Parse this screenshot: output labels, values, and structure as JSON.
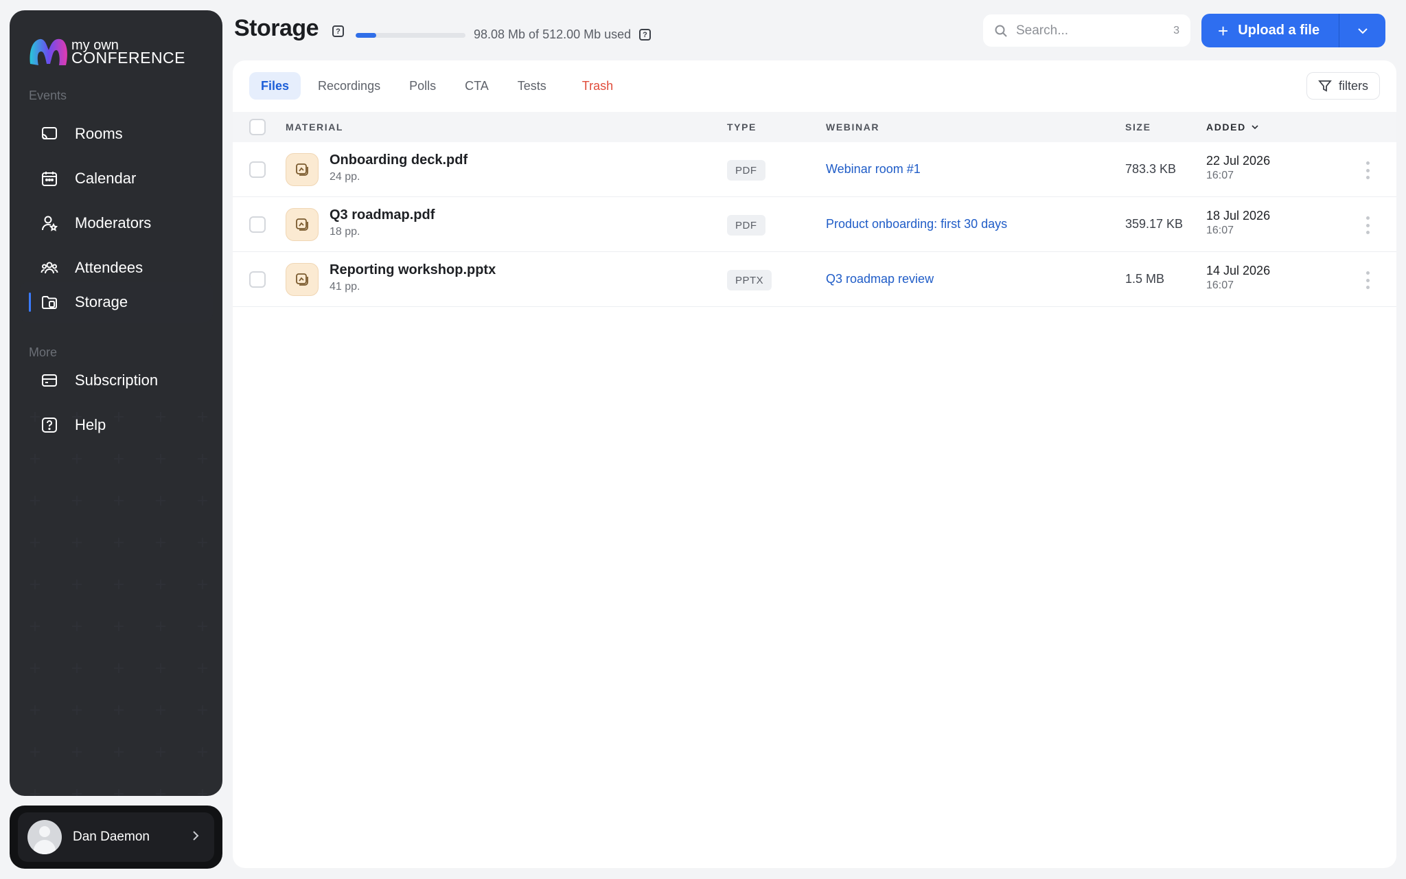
{
  "brand": {
    "line1": "my own",
    "line2": "CONFERENCE"
  },
  "sidebar": {
    "section_events": "Events",
    "section_more": "More",
    "items": [
      {
        "label": "Rooms",
        "icon": "cast-icon"
      },
      {
        "label": "Calendar",
        "icon": "calendar-icon"
      },
      {
        "label": "Moderators",
        "icon": "moderator-icon"
      },
      {
        "label": "Attendees",
        "icon": "attendees-icon"
      },
      {
        "label": "Storage",
        "icon": "storage-icon",
        "active": true
      },
      {
        "label": "Subscription",
        "icon": "card-icon"
      },
      {
        "label": "Help",
        "icon": "help-icon"
      }
    ],
    "user": {
      "name": "Dan Daemon"
    }
  },
  "header": {
    "title": "Storage",
    "usage_text": "98.08 Mb of 512.00 Mb used",
    "usage_fraction": 0.19,
    "search_placeholder": "Search...",
    "search_count": "3",
    "upload_label": "Upload a file"
  },
  "tabs": [
    {
      "label": "Files",
      "active": true
    },
    {
      "label": "Recordings"
    },
    {
      "label": "Polls"
    },
    {
      "label": "CTA"
    },
    {
      "label": "Tests"
    },
    {
      "label": "Trash",
      "danger": true
    }
  ],
  "filters_label": "filters",
  "table": {
    "headers": {
      "material": "MATERIAL",
      "type": "TYPE",
      "webinar": "WEBINAR",
      "size": "SIZE",
      "added": "ADDED"
    },
    "rows": [
      {
        "name": "Onboarding deck.pdf",
        "pages": "24 pp.",
        "type": "PDF",
        "webinar": "Webinar room #1",
        "size": "783.3 KB",
        "date": "22 Jul 2026",
        "time": "16:07"
      },
      {
        "name": "Q3 roadmap.pdf",
        "pages": "18 pp.",
        "type": "PDF",
        "webinar": "Product onboarding: first 30 days",
        "size": "359.17 KB",
        "date": "18 Jul 2026",
        "time": "16:07"
      },
      {
        "name": "Reporting workshop.pptx",
        "pages": "41 pp.",
        "type": "PPTX",
        "webinar": "Q3 roadmap review",
        "size": "1.5 MB",
        "date": "14 Jul 2026",
        "time": "16:07"
      }
    ]
  },
  "colors": {
    "accent": "#2e6ef0",
    "sidebar_bg": "#111214",
    "danger": "#e04b3a",
    "link": "#1f5cc7"
  }
}
